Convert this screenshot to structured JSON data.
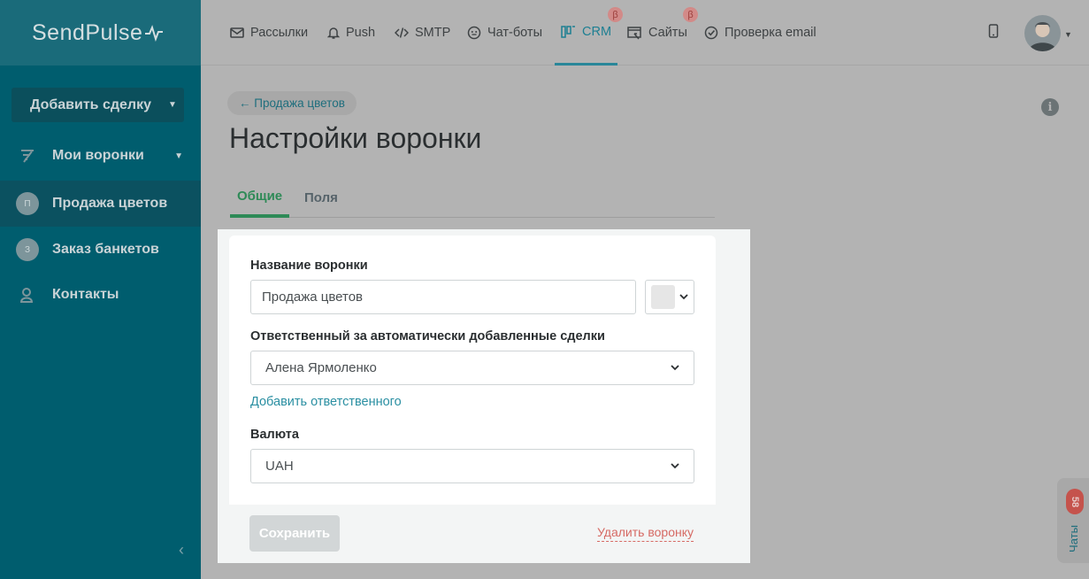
{
  "app": {
    "logo": "SendPulse"
  },
  "sidebar": {
    "add_deal_label": "Добавить сделку",
    "funnels_label": "Мои воронки",
    "items": [
      {
        "initial": "П",
        "label": "Продажа цветов"
      },
      {
        "initial": "З",
        "label": "Заказ банкетов"
      }
    ],
    "contacts_label": "Контакты"
  },
  "topnav": {
    "items": [
      {
        "label": "Рассылки",
        "icon": "mail-icon"
      },
      {
        "label": "Push",
        "icon": "bell-icon"
      },
      {
        "label": "SMTP",
        "icon": "code-icon"
      },
      {
        "label": "Чат-боты",
        "icon": "chatbot-icon"
      },
      {
        "label": "CRM",
        "icon": "crm-icon",
        "beta": "β"
      },
      {
        "label": "Сайты",
        "icon": "sites-icon",
        "beta": "β"
      },
      {
        "label": "Проверка email",
        "icon": "check-icon"
      }
    ]
  },
  "page": {
    "back_label": "← Продажа цветов",
    "title": "Настройки воронки",
    "tabs": [
      "Общие",
      "Поля"
    ]
  },
  "form": {
    "name_label": "Название воронки",
    "name_value": "Продажа цветов",
    "color_value": "#e6e6e6",
    "responsible_label": "Ответственный за автоматически добавленные сделки",
    "responsible_value": "Алена Ярмоленко",
    "add_responsible_label": "Добавить ответственного",
    "currency_label": "Валюта",
    "currency_value": "UAH",
    "save_label": "Сохранить",
    "delete_label": "Удалить воронку"
  },
  "chats": {
    "label": "Чаты",
    "count": "58"
  },
  "colors": {
    "sidebar": "#005d6e",
    "accent": "#2a8799",
    "tab_active": "#2e8a57",
    "danger": "#d66a64"
  }
}
